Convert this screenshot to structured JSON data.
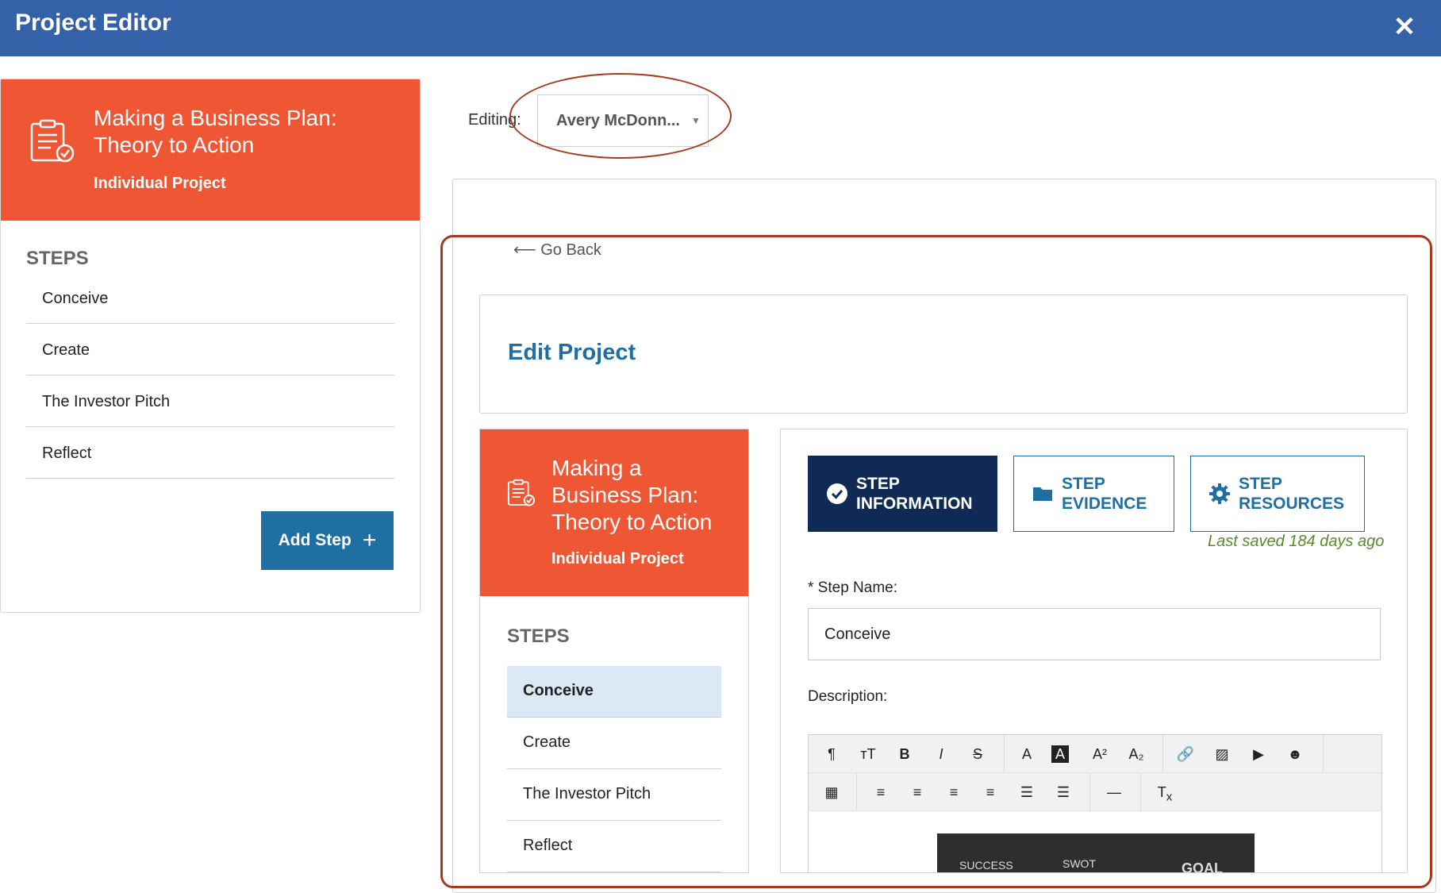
{
  "header": {
    "title": "Project Editor",
    "close_icon": "close-icon"
  },
  "sidebar": {
    "project_title": "Making a Business Plan: Theory to Action",
    "project_subtitle": "Individual Project",
    "steps_heading": "STEPS",
    "steps": [
      "Conceive",
      "Create",
      "The Investor Pitch",
      "Reflect"
    ],
    "add_step_label": "Add Step",
    "add_step_icon": "plus-icon"
  },
  "editing": {
    "label": "Editing:",
    "selected": "Avery McDonn...",
    "caret_icon": "caret-down-icon"
  },
  "editor": {
    "go_back": "Go Back",
    "heading": "Edit Project",
    "project_title": "Making a Business Plan: Theory to Action",
    "project_subtitle": "Individual Project",
    "steps_heading": "STEPS",
    "steps": [
      "Conceive",
      "Create",
      "The Investor Pitch",
      "Reflect"
    ],
    "active_step": "Conceive",
    "tabs": [
      {
        "line1": "STEP",
        "line2": "INFORMATION",
        "icon": "check-circle-icon",
        "active": true
      },
      {
        "line1": "STEP",
        "line2": "EVIDENCE",
        "icon": "folder-icon",
        "active": false
      },
      {
        "line1": "STEP",
        "line2": "RESOURCES",
        "icon": "gear-icon",
        "active": false
      }
    ],
    "last_saved": "Last saved 184 days ago",
    "step_name_label": "* Step Name:",
    "step_name_value": "Conceive",
    "description_label": "Description:",
    "image_texts": [
      "SUCCESS",
      "SWOT",
      "GOAL"
    ]
  },
  "colors": {
    "header": "#3461a8",
    "accent_orange": "#ee5634",
    "primary_blue": "#1f6fa3",
    "dark_navy": "#0f2a55",
    "annotation": "#a63a1e",
    "saved_green": "#5a8a2a"
  }
}
